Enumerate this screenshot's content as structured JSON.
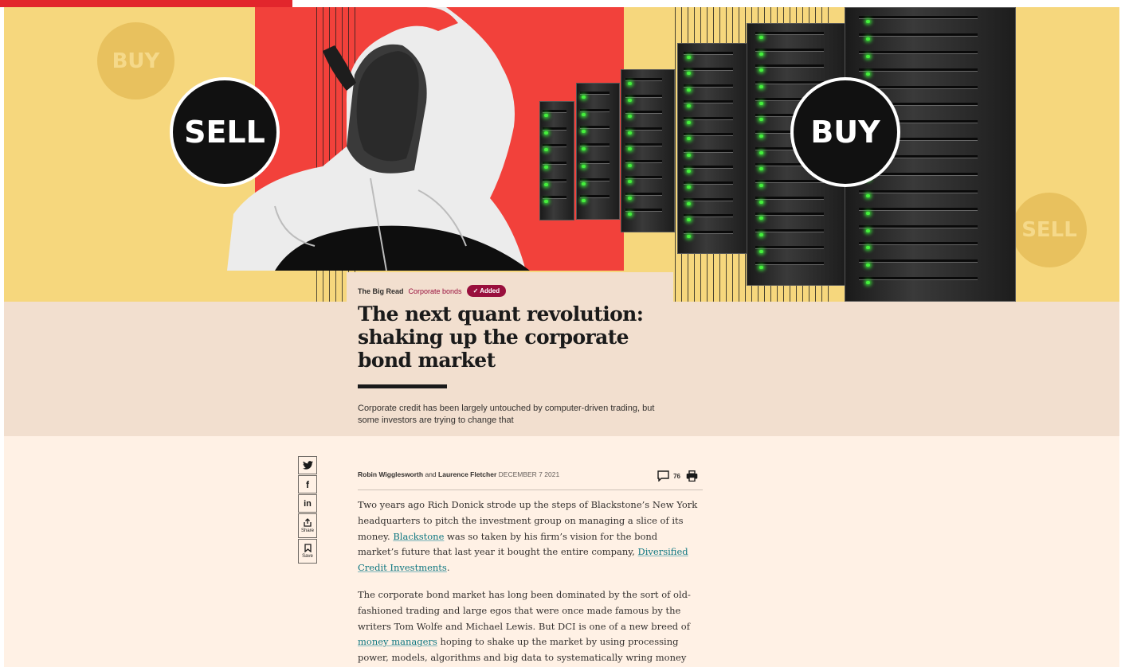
{
  "reading_progress": 0.26,
  "colors": {
    "accent_claret": "#990f3d",
    "page_bg": "#fff1e5",
    "band_bg": "#f2dfcf",
    "hero_yellow": "#f6d77d",
    "hero_red": "#f2413b",
    "link_teal": "#0d7680"
  },
  "hero": {
    "circles": {
      "sell_big": "SELL",
      "buy_big": "BUY",
      "buy_faint": "BUY",
      "sell_faint": "SELL"
    }
  },
  "article": {
    "series": "The Big Read",
    "topic": "Corporate bonds",
    "added_label": "Added",
    "headline": "The next quant revolution: shaking up the corporate bond market",
    "standfirst": "Corporate credit has been largely untouched by computer-driven trading, but some investors are trying to change that",
    "author1": "Robin Wigglesworth",
    "and": "and",
    "author2": "Laurence Fletcher",
    "date": "DECEMBER 7 2021",
    "comment_count": "76",
    "p1": {
      "t1": "Two years ago Rich Donick strode up the steps of Blackstone’s New York headquarters to pitch the investment group on managing a slice of its money.",
      "link1": "Blackstone",
      "t2": " was so taken by his firm’s vision for the bond market’s future that last year it bought the entire company, ",
      "link2": "Diversified Credit Investments",
      "t3": "."
    },
    "p2": {
      "t1": "The corporate bond market has long been dominated by the sort of old-fashioned trading and large egos that were once made famous by the writers Tom Wolfe and Michael Lewis. But DCI is one of a new breed of ",
      "link1": "money managers",
      "t2": " hoping to shake up the market by using processing power, models, algorithms and big data to systematically wring money out of pricing anomalies."
    }
  },
  "share": {
    "share_label": "Share",
    "save_label": "Save"
  },
  "icons": [
    "twitter-icon",
    "facebook-icon",
    "linkedin-icon",
    "share-icon",
    "bookmark-icon",
    "comment-icon",
    "print-icon",
    "check-icon"
  ]
}
